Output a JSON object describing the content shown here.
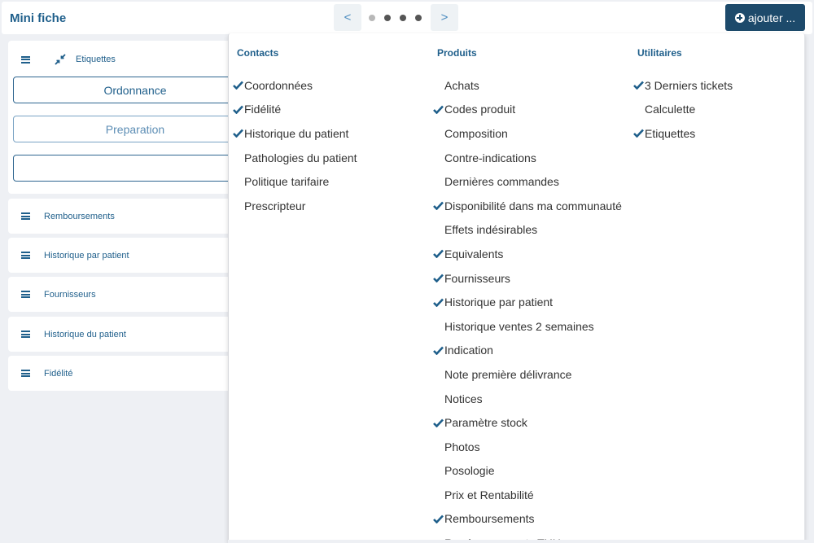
{
  "header": {
    "title": "Mini fiche",
    "pager": {
      "prev_label": "<",
      "next_label": ">",
      "total_pages": 4,
      "current_page": 1
    },
    "add_button": {
      "label": "ajouter ...",
      "icon": "plus-circle-icon"
    }
  },
  "colors": {
    "accent": "#1f5f8b",
    "add_button_bg": "#1d4a6b",
    "background": "#eef0f4"
  },
  "main_panel": {
    "title": "Etiquettes",
    "icons": [
      "menu-icon",
      "compress-icon"
    ],
    "buttons": [
      {
        "label": "Ordonnance"
      },
      {
        "label": "Preparation"
      },
      {
        "label": ""
      }
    ]
  },
  "cards": [
    {
      "label": "Remboursements"
    },
    {
      "label": "Historique par patient"
    },
    {
      "label": "Fournisseurs"
    },
    {
      "label": "Historique du patient"
    },
    {
      "label": "Fidélité"
    }
  ],
  "dropdown": {
    "columns": [
      {
        "title": "Contacts",
        "items": [
          {
            "label": "Coordonnées",
            "checked": true
          },
          {
            "label": "Fidélité",
            "checked": true
          },
          {
            "label": "Historique du patient",
            "checked": true
          },
          {
            "label": "Pathologies du patient",
            "checked": false
          },
          {
            "label": "Politique tarifaire",
            "checked": false
          },
          {
            "label": "Prescripteur",
            "checked": false
          }
        ]
      },
      {
        "title": "Produits",
        "items": [
          {
            "label": "Achats",
            "checked": false
          },
          {
            "label": "Codes produit",
            "checked": true
          },
          {
            "label": "Composition",
            "checked": false
          },
          {
            "label": "Contre-indications",
            "checked": false
          },
          {
            "label": "Dernières commandes",
            "checked": false
          },
          {
            "label": "Disponibilité dans ma communauté",
            "checked": true
          },
          {
            "label": "Effets indésirables",
            "checked": false
          },
          {
            "label": "Equivalents",
            "checked": true
          },
          {
            "label": "Fournisseurs",
            "checked": true
          },
          {
            "label": "Historique par patient",
            "checked": true
          },
          {
            "label": "Historique ventes 2 semaines",
            "checked": false
          },
          {
            "label": "Indication",
            "checked": true
          },
          {
            "label": "Note première délivrance",
            "checked": false
          },
          {
            "label": "Notices",
            "checked": false
          },
          {
            "label": "Paramètre stock",
            "checked": true
          },
          {
            "label": "Photos",
            "checked": false
          },
          {
            "label": "Posologie",
            "checked": false
          },
          {
            "label": "Prix et Rentabilité",
            "checked": false
          },
          {
            "label": "Remboursements",
            "checked": true
          },
          {
            "label": "Remboursements TUH",
            "checked": false
          }
        ]
      },
      {
        "title": "Utilitaires",
        "items": [
          {
            "label": "3 Derniers tickets",
            "checked": true
          },
          {
            "label": "Calculette",
            "checked": false
          },
          {
            "label": "Etiquettes",
            "checked": true
          }
        ]
      }
    ]
  }
}
